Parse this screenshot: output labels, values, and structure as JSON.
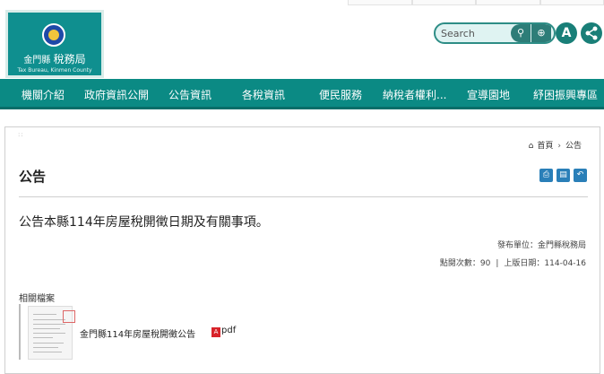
{
  "header": {
    "logo": {
      "name": "金門縣稅務局",
      "name_prefix": "金門縣",
      "name_main": "稅務局",
      "name_en": "Tax Bureau, Kinmen County"
    },
    "search": {
      "placeholder": "Search"
    },
    "font_size_button": "A",
    "icons": [
      "search-icon",
      "advanced-search-icon",
      "font-size-icon",
      "share-icon"
    ]
  },
  "nav": {
    "items": [
      "機關介紹",
      "政府資訊公開",
      "公告資訊",
      "各稅資訊",
      "便民服務",
      "納稅者權利...",
      "宣導園地",
      "紓困振興專區"
    ]
  },
  "breadcrumb": {
    "home": "首頁",
    "current": "公告"
  },
  "page": {
    "title": "公告",
    "tools": [
      "print-icon",
      "chart-icon",
      "back-icon"
    ],
    "headline": "公告本縣114年房屋稅開徵日期及有關事項。",
    "publisher": "發布單位：金門縣稅務局",
    "views": "點閱次數：90",
    "date": "上版日期：114-04-16"
  },
  "files": {
    "label": "相關檔案",
    "items": [
      {
        "name": "金門縣114年房屋稅開徵公告",
        "type": "pdf"
      }
    ]
  },
  "colors": {
    "brand": "#0b8a84",
    "accent": "#2a7fb8",
    "pdf": "#d8232a"
  }
}
